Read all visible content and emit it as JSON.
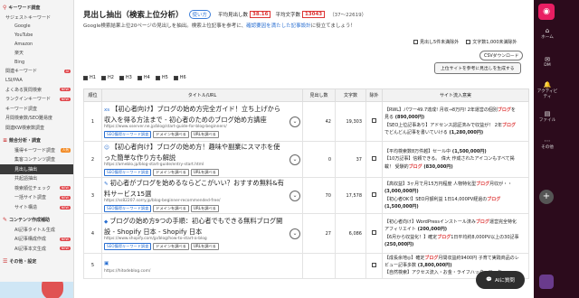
{
  "sidebar": {
    "sections": [
      {
        "icon": "search-icon",
        "label": "キーワード調査"
      },
      {
        "icon": "list-icon",
        "label": "競合分析・調査"
      },
      {
        "icon": "gear-icon",
        "label": "コンテンツ作成補助"
      },
      {
        "icon": "menu-icon",
        "label": "その他・設定"
      }
    ],
    "kw_items": [
      {
        "label": "サジェストキーワード",
        "badge": ""
      },
      {
        "label": "Google",
        "badge": ""
      },
      {
        "label": "YouTube",
        "badge": ""
      },
      {
        "label": "Amazon",
        "badge": ""
      },
      {
        "label": "楽天",
        "badge": ""
      },
      {
        "label": "Bing",
        "badge": ""
      },
      {
        "label": "関連キーワード",
        "badge": "AI"
      },
      {
        "label": "LSI/PAA",
        "badge": ""
      },
      {
        "label": "よくある質問検索",
        "badge": "NEW"
      },
      {
        "label": "ランクインキーワード",
        "badge": "NEW"
      },
      {
        "label": "キーワード調査",
        "badge": ""
      },
      {
        "label": "月間検索数/SEO難易度",
        "badge": ""
      },
      {
        "label": "関連KW検索数調査",
        "badge": ""
      }
    ],
    "comp_items": [
      {
        "label": "獲得キーワード調査",
        "badge": "人気",
        "active": false
      },
      {
        "label": "集客コンテンツ調査",
        "badge": "",
        "active": false
      },
      {
        "label": "見出し抽出",
        "badge": "",
        "active": true
      },
      {
        "label": "共起語抽出",
        "badge": "",
        "active": false
      },
      {
        "label": "検索順位チェック",
        "badge": "NEW",
        "active": false
      },
      {
        "label": "一括サイト調査",
        "badge": "NEW",
        "active": false
      },
      {
        "label": "サイト構造",
        "badge": "NEW",
        "active": false
      }
    ],
    "content_items": [
      {
        "label": "AI記事タイトル生成",
        "badge": ""
      },
      {
        "label": "AI記事構成作成",
        "badge": "NEW"
      },
      {
        "label": "AI記事本文生成",
        "badge": "NEW"
      }
    ]
  },
  "header": {
    "title": "見出し抽出（検索上位分析）",
    "usage": "使い方",
    "avg_heading_label": "平均見出し数",
    "avg_heading": "38.16",
    "avg_chars_label": "平均文字数",
    "avg_chars": "13043",
    "range": "（37〜22619）"
  },
  "description": {
    "text": "Google検索結果上位20ページの見出しを抽出。検索上位記事を参考に、",
    "link": "確認要因を満たした記事設計",
    "tail": "に役立てましょう！"
  },
  "controls": {
    "exclude_five": "見出し5件未満除外",
    "exclude_chars": "文字数1,000未満除外",
    "csv": "CSVダウンロード",
    "generate": "上位サイトを参考に見出しを生成する"
  },
  "heading_filters": [
    "H1",
    "H2",
    "H3",
    "H4",
    "H5",
    "H6"
  ],
  "table": {
    "headers": {
      "rank": "順位",
      "title": "タイトル/URL",
      "count": "見出し数",
      "chars": "文字数",
      "exclude": "除外",
      "sites": "サイト流入意実"
    },
    "seo_tag": "SEO獲得キーワード調査",
    "domain_tag": "ドメインを調べる",
    "url_tag": "URLを調べる",
    "rows": [
      {
        "rank": "1",
        "fav": "xs",
        "title": "【初心者向け】ブログの始め方完全ガイド！立ち上げから収入を得る方法まで - 初心者のためのブログ始め方講座",
        "url": "https://www.xserver.ne.jp/blog/start-guide-for-blog-beginners/",
        "count": "42",
        "chars": "19,303",
        "sites": [
          {
            "text": "【RWL】パワー49.7達成! 月収→8万円! 2年運営の個別",
            "hl": "ブログ",
            "tail": "を見る",
            "cnt": "(890,000円)"
          },
          {
            "text": "【SEO上位記事あり】アドセンス認証済みで収益が！ 2年",
            "hl": "ブログ",
            "tail": "でどんどん記事を書いていける",
            "cnt": "(1,280,000円)"
          }
        ]
      },
      {
        "rank": "2",
        "fav": "☺",
        "title": "【初心者向け】ブログの始め方！趣味や副業にスマホを使った簡単な作り方も解説",
        "url": "https://ameblo.jp/blog-start-guide/entry-start.html",
        "count": "0",
        "chars": "37",
        "sites": [
          {
            "text": "【平均検索数8万件越】セール中",
            "hl": "",
            "tail": "",
            "cnt": "(1,500,000円)"
          },
          {
            "text": "【10万記事】信頼できる。 偉大 作成されたアイコンもすべて掲載！ 受験的",
            "hl": "ブログ",
            "tail": "",
            "cnt": "(830,000円)"
          }
        ]
      },
      {
        "rank": "3",
        "fav": "✎",
        "title": "初心者がブログを始めるならどこがいい？おすすめ無料&有料サービス15選",
        "url": "https://ss82207.sorry.jp/blog-beginner-recommended-free/",
        "count": "70",
        "chars": "17,578",
        "sites": [
          {
            "text": "【高収益】3ヶ月で月15万円程度 人物特化型",
            "hl": "ブログ",
            "tail": "月収が・・",
            "cnt": "(3,000,000円)"
          },
          {
            "text": "【初心者OK!】SEO月額利益 1日14,000PV経過の",
            "hl": "ブログ",
            "tail": "",
            "cnt": "(1,500,000円)"
          }
        ]
      },
      {
        "rank": "4",
        "fav": "◆",
        "title": "ブログの始め方9つの手順：初心者でもできる無料ブログ開設 - Shopify 日本 - Shopify 日本",
        "url": "https://www.shopify.com/jp/blog/how-to-start-a-blog",
        "count": "27",
        "chars": "6,086",
        "sites": [
          {
            "text": "【初心者向け】WordPressインストール済み",
            "hl": "ブログ",
            "tail": "運営完全特化アフィリエイト",
            "cnt": "(200,000円)"
          },
          {
            "text": "【6月から収益化！】確定",
            "hl": "ブログ",
            "tail": "1日平均約8,000PV以上の30記事",
            "cnt": "(250,000円)"
          }
        ]
      },
      {
        "rank": "5",
        "fav": "▣",
        "title": "",
        "url": "https://hitodeblog.com/",
        "count": "",
        "chars": "",
        "sites": [
          {
            "text": "【成長余地◎】確定",
            "hl": "ブログ",
            "tail": "月間収益約9400円 子育て実践商品のレビュー記事多数",
            "cnt": "(3,800,000円)"
          },
          {
            "text": "【自然検索】アクセス流入・お金・ライフハック・マーケ",
            "hl": "",
            "tail": "",
            "cnt": ""
          }
        ]
      }
    ]
  },
  "right_toolbar": {
    "items": [
      {
        "icon": "home-icon",
        "label": "ホーム"
      },
      {
        "icon": "message-icon",
        "label": "DM"
      },
      {
        "icon": "bell-icon",
        "label": "アクティビティ"
      },
      {
        "icon": "file-icon",
        "label": "ファイル"
      },
      {
        "icon": "more-icon",
        "label": "その他"
      }
    ]
  },
  "ai_button": "AIに質問"
}
